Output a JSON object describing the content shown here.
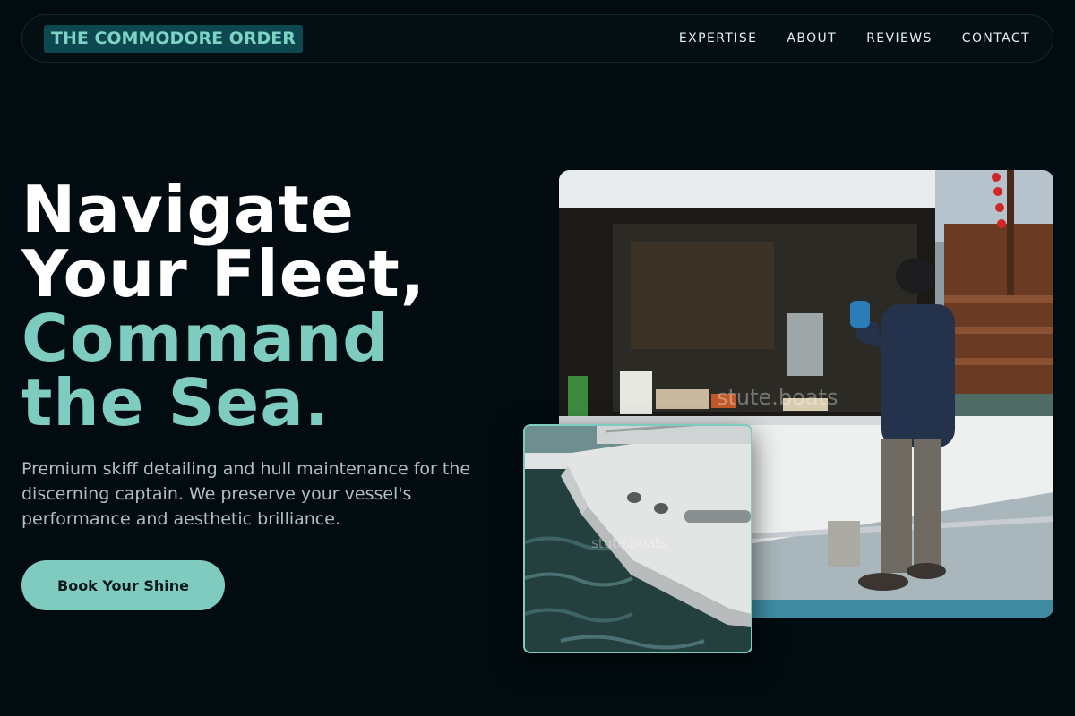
{
  "brand": {
    "name": "THE COMMODORE ORDER"
  },
  "nav": {
    "items": [
      {
        "label": "EXPERTISE"
      },
      {
        "label": "ABOUT"
      },
      {
        "label": "REVIEWS"
      },
      {
        "label": "CONTACT"
      }
    ]
  },
  "hero": {
    "headline_line1": "Navigate",
    "headline_line2": "Your Fleet,",
    "headline_line3": "Command",
    "headline_line4": "the Sea.",
    "subtitle": "Premium skiff detailing and hull maintenance for the discerning captain. We preserve your vessel's performance and aesthetic brilliance.",
    "cta_label": "Book Your Shine"
  },
  "images": {
    "main_watermark": "stute.boats",
    "small_watermark": "stute.boats"
  },
  "colors": {
    "background": "#020c10",
    "accent": "#7ecbbf",
    "brand_bg": "#0d4750"
  }
}
